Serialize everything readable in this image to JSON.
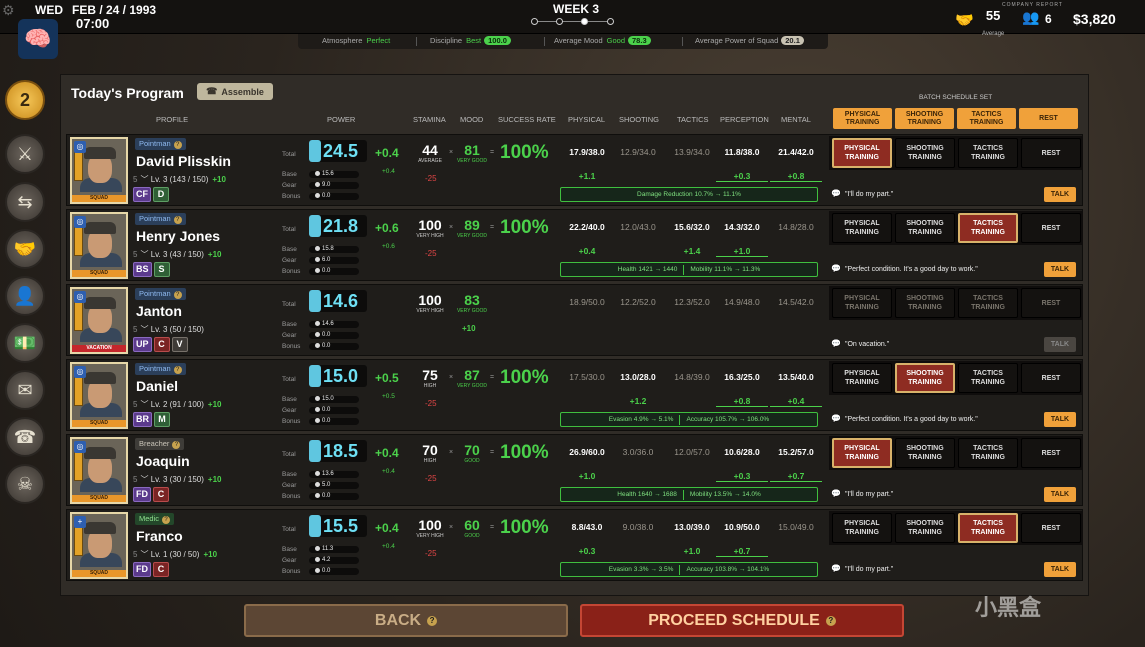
{
  "topbar": {
    "day": "WED",
    "date": "FEB / 24 / 1993",
    "time": "07:00",
    "week": "WEEK 3",
    "report_label": "COMPANY REPORT",
    "avg_value": "55",
    "avg_label": "Average",
    "people_value": "6",
    "money": "$3,820"
  },
  "stats": {
    "atmosphere_label": "Atmosphere",
    "atmosphere_value": "Perfect",
    "discipline_label": "Discipline",
    "discipline_word": "Best",
    "discipline_value": "100.0",
    "mood_label": "Average Mood",
    "mood_word": "Good",
    "mood_value": "78.3",
    "power_label": "Average Power of Squad",
    "power_value": "20.1"
  },
  "sidebar": {
    "timer_value": "2"
  },
  "panel": {
    "title": "Today's Program",
    "assemble": "Assemble",
    "batch_label": "BATCH SCHEDULE SET",
    "cols": {
      "profile": "PROFILE",
      "power": "POWER",
      "stamina": "STAMINA",
      "mood": "MOOD",
      "success": "SUCCESS RATE",
      "physical": "PHYSICAL",
      "shooting": "SHOOTING",
      "tactics": "TACTICS",
      "perception": "PERCEPTION",
      "mental": "MENTAL"
    },
    "batch": [
      "PHYSICAL TRAINING",
      "SHOOTING TRAINING",
      "TACTICS TRAINING",
      "REST"
    ],
    "power_labels": {
      "total": "Total",
      "base": "Base",
      "gear": "Gear",
      "bonus": "Bonus"
    },
    "sched_labels": [
      "PHYSICAL TRAINING",
      "SHOOTING TRAINING",
      "TACTICS TRAINING",
      "REST"
    ],
    "talk": "TALK"
  },
  "rows": [
    {
      "cls": "Pointman",
      "name": "David Plisskin",
      "lv_num": "5",
      "lv": "Lv. 3",
      "xp": "(143 / 150)",
      "plus": "+10",
      "traits": [
        "CF",
        "D"
      ],
      "tag": "SQUAD",
      "power": "24.5",
      "pdelta": "+0.4",
      "base": "15.6",
      "gear": "9.0",
      "bonus": "0.0",
      "psmall": "+0.4",
      "red": "-25",
      "stamina": "44",
      "stam_word": "AVERAGE",
      "mood": "81",
      "mood_word": "VERY GOOD",
      "mood_delta": "",
      "success": "100%",
      "phys": "17.9/38.0",
      "shoot": "12.9/34.0",
      "tact": "13.9/34.0",
      "perc": "11.8/38.0",
      "ment": "21.4/42.0",
      "d_phys": "+1.1",
      "d_shoot": "",
      "d_tact": "",
      "d_perc": "+0.3",
      "d_ment": "+0.8",
      "info1": "Damage Reduction 10.7% → 11.1%",
      "info2": "",
      "quote": "\"I'll do my part.\"",
      "sched": 0
    },
    {
      "cls": "Pointman",
      "name": "Henry Jones",
      "lv_num": "5",
      "lv": "Lv. 3",
      "xp": "(43 / 150)",
      "plus": "+10",
      "traits": [
        "BS",
        "S"
      ],
      "tag": "SQUAD",
      "power": "21.8",
      "pdelta": "+0.6",
      "base": "15.8",
      "gear": "6.0",
      "bonus": "0.0",
      "psmall": "+0.6",
      "red": "-25",
      "stamina": "100",
      "stam_word": "VERY HIGH",
      "mood": "89",
      "mood_word": "VERY GOOD",
      "mood_delta": "",
      "success": "100%",
      "phys": "22.2/40.0",
      "shoot": "12.0/43.0",
      "tact": "15.6/32.0",
      "perc": "14.3/32.0",
      "ment": "14.8/28.0",
      "d_phys": "+0.4",
      "d_shoot": "",
      "d_tact": "+1.4",
      "d_perc": "+1.0",
      "d_ment": "",
      "info1": "Health 1421 → 1440",
      "info2": "Mobility 11.1% → 11.3%",
      "quote": "\"Perfect condition. It's a good day to work.\"",
      "sched": 2
    },
    {
      "cls": "Pointman",
      "name": "Janton",
      "lv_num": "5",
      "lv": "Lv. 3",
      "xp": "(50 / 150)",
      "plus": "",
      "traits": [
        "UP",
        "C",
        "V"
      ],
      "tag": "VACATION",
      "power": "14.6",
      "pdelta": "",
      "base": "14.6",
      "gear": "0.0",
      "bonus": "0.0",
      "psmall": "",
      "red": "",
      "stamina": "100",
      "stam_word": "VERY HIGH",
      "mood": "83",
      "mood_word": "VERY GOOD",
      "mood_delta": "+10",
      "success": "",
      "phys": "18.9/50.0",
      "shoot": "12.2/52.0",
      "tact": "12.3/52.0",
      "perc": "14.9/48.0",
      "ment": "14.5/42.0",
      "d_phys": "",
      "d_shoot": "",
      "d_tact": "",
      "d_perc": "",
      "d_ment": "",
      "info1": "",
      "info2": "",
      "quote": "\"On vacation.\"",
      "sched": -1
    },
    {
      "cls": "Pointman",
      "name": "Daniel",
      "lv_num": "5",
      "lv": "Lv. 2",
      "xp": "(91 / 100)",
      "plus": "+10",
      "traits": [
        "BR",
        "M"
      ],
      "tag": "SQUAD",
      "power": "15.0",
      "pdelta": "+0.5",
      "base": "15.0",
      "gear": "0.0",
      "bonus": "0.0",
      "psmall": "+0.5",
      "red": "-25",
      "stamina": "75",
      "stam_word": "HIGH",
      "mood": "87",
      "mood_word": "VERY GOOD",
      "mood_delta": "",
      "success": "100%",
      "phys": "17.5/30.0",
      "shoot": "13.0/28.0",
      "tact": "14.8/39.0",
      "perc": "16.3/25.0",
      "ment": "13.5/40.0",
      "d_phys": "",
      "d_shoot": "+1.2",
      "d_tact": "",
      "d_perc": "+0.8",
      "d_ment": "+0.4",
      "info1": "Evasion 4.9% → 5.1%",
      "info2": "Accuracy 105.7% → 106.0%",
      "quote": "\"Perfect condition. It's a good day to work.\"",
      "sched": 1
    },
    {
      "cls": "Breacher",
      "name": "Joaquin",
      "lv_num": "5",
      "lv": "Lv. 3",
      "xp": "(30 / 150)",
      "plus": "+10",
      "traits": [
        "FD",
        "C"
      ],
      "tag": "SQUAD",
      "power": "18.5",
      "pdelta": "+0.4",
      "base": "13.6",
      "gear": "5.0",
      "bonus": "0.0",
      "psmall": "+0.4",
      "red": "-25",
      "stamina": "70",
      "stam_word": "HIGH",
      "mood": "70",
      "mood_word": "GOOD",
      "mood_delta": "",
      "success": "100%",
      "phys": "26.9/60.0",
      "shoot": "3.0/36.0",
      "tact": "12.0/57.0",
      "perc": "10.6/28.0",
      "ment": "15.2/57.0",
      "d_phys": "+1.0",
      "d_shoot": "",
      "d_tact": "",
      "d_perc": "+0.3",
      "d_ment": "+0.7",
      "info1": "Health 1640 → 1688",
      "info2": "Mobility 13.5% → 14.0%",
      "quote": "\"I'll do my part.\"",
      "sched": 0
    },
    {
      "cls": "Medic",
      "name": "Franco",
      "lv_num": "5",
      "lv": "Lv. 1",
      "xp": "(30 / 50)",
      "plus": "+10",
      "traits": [
        "FD",
        "C"
      ],
      "tag": "SQUAD",
      "power": "15.5",
      "pdelta": "+0.4",
      "base": "11.3",
      "gear": "4.2",
      "bonus": "0.0",
      "psmall": "+0.4",
      "red": "-25",
      "stamina": "100",
      "stam_word": "VERY HIGH",
      "mood": "60",
      "mood_word": "GOOD",
      "mood_delta": "",
      "success": "100%",
      "phys": "8.8/43.0",
      "shoot": "9.0/38.0",
      "tact": "13.0/39.0",
      "perc": "10.9/50.0",
      "ment": "15.0/49.0",
      "d_phys": "+0.3",
      "d_shoot": "",
      "d_tact": "+1.0",
      "d_perc": "+0.7",
      "d_ment": "",
      "info1": "Evasion 3.3% → 3.5%",
      "info2": "Accuracy 103.8% → 104.1%",
      "quote": "\"I'll do my part.\"",
      "sched": 2
    }
  ],
  "footer": {
    "back": "BACK",
    "proceed": "PROCEED SCHEDULE",
    "watermark": "小黑盒"
  }
}
